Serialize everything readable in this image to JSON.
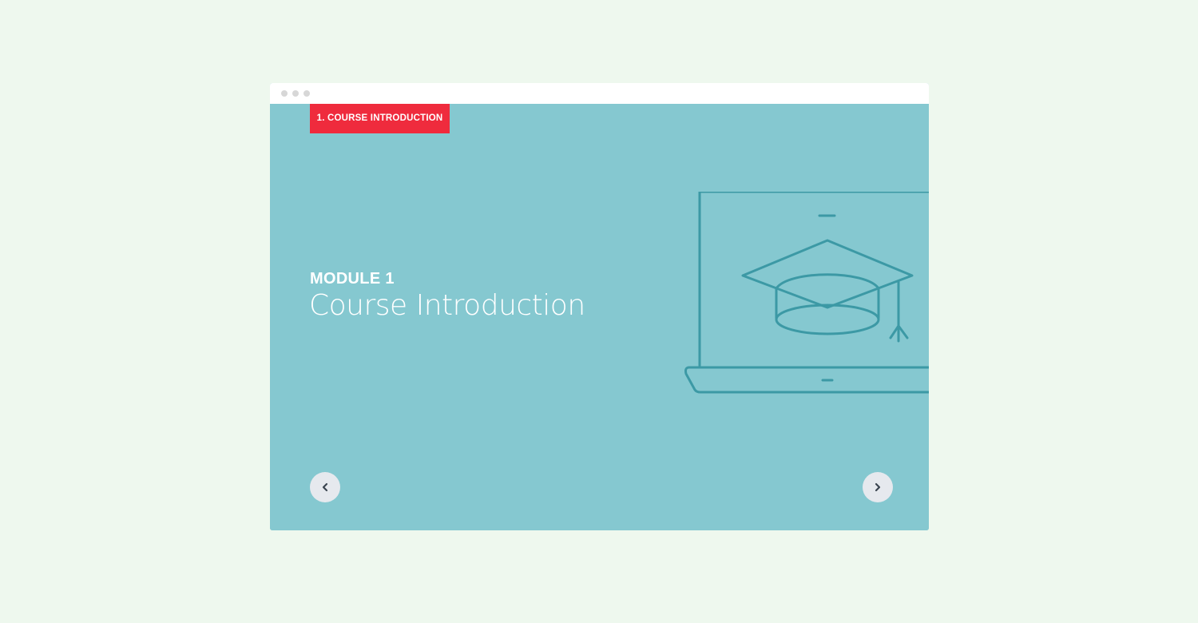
{
  "tag": {
    "label": "1. COURSE INTRODUCTION",
    "color": "#ef2b3d"
  },
  "module": {
    "label": "MODULE 1",
    "title": "Course Introduction"
  },
  "colors": {
    "page_background": "#eef8ee",
    "slide_background": "#85c8d0",
    "illustration_stroke": "#3c99a5",
    "nav_button": "#e6e9ee",
    "nav_arrow": "#3b4550"
  },
  "icons": {
    "illustration": "laptop-graduation-cap-icon",
    "previous": "chevron-left-icon",
    "next": "chevron-right-icon"
  }
}
